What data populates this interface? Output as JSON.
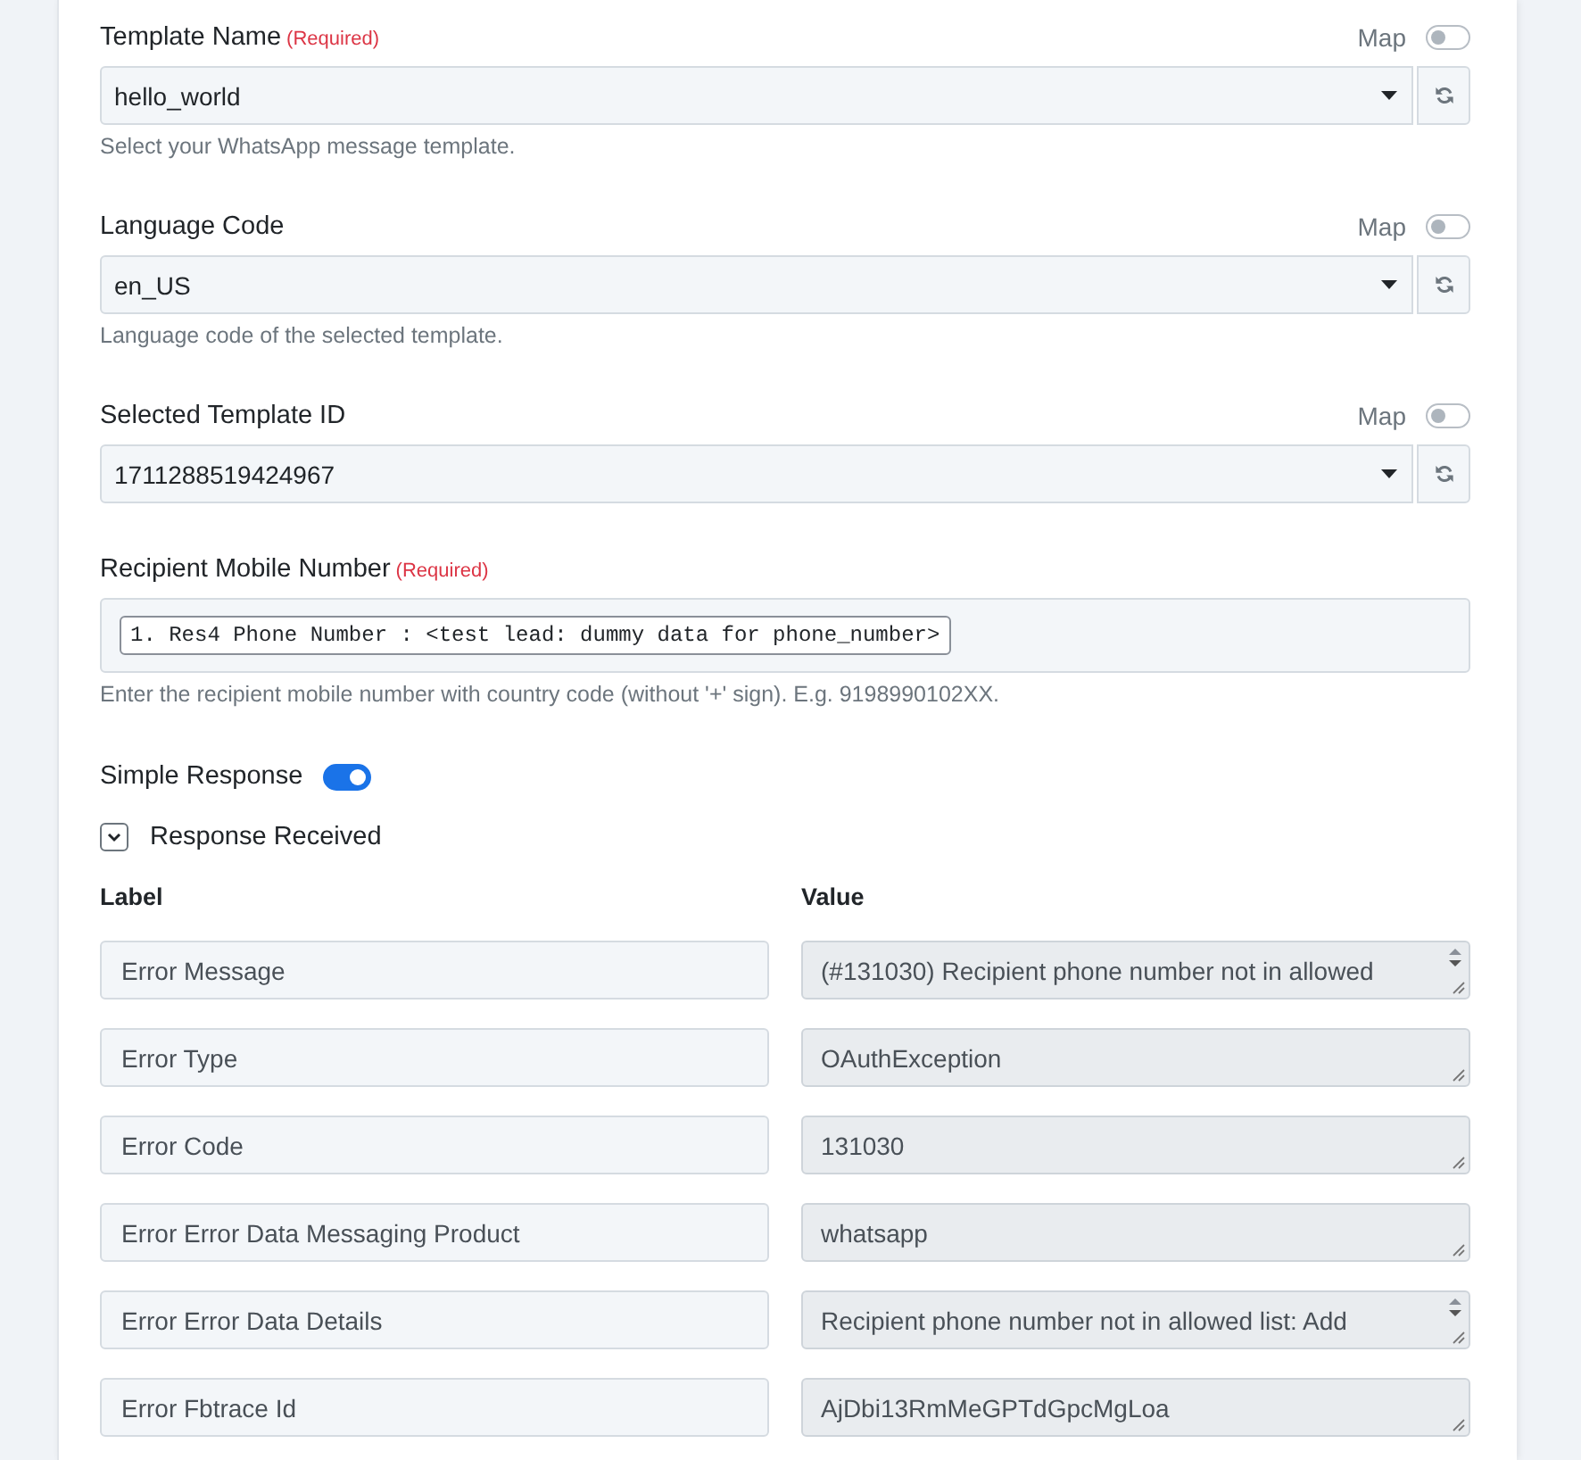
{
  "fields": [
    {
      "kind": "select",
      "label": "Template Name",
      "required_note": "(Required)",
      "map": {
        "label": "Map",
        "on": false
      },
      "value": "hello_world",
      "hint": "Select your WhatsApp message template."
    },
    {
      "kind": "select",
      "label": "Language Code",
      "map": {
        "label": "Map",
        "on": false
      },
      "value": "en_US",
      "hint": "Language code of the selected template."
    },
    {
      "kind": "select",
      "label": "Selected Template ID",
      "map": {
        "label": "Map",
        "on": false
      },
      "value": "1711288519424967"
    },
    {
      "kind": "tokens",
      "label": "Recipient Mobile Number",
      "required_note": "(Required)",
      "tokens": [
        "1. Res4 Phone Number : <test lead: dummy data for phone_number>"
      ],
      "hint": "Enter the recipient mobile number with country code (without '+' sign). E.g. 9198990102XX."
    }
  ],
  "simple_response": {
    "label": "Simple Response",
    "on": true
  },
  "response": {
    "label": "Response Received",
    "expanded": true,
    "columns": [
      "Label",
      "Value"
    ],
    "rows": [
      {
        "label": "Error Message",
        "value": "(#131030) Recipient phone number not in allowed",
        "scrollable": true
      },
      {
        "label": "Error Type",
        "value": "OAuthException",
        "scrollable": false
      },
      {
        "label": "Error Code",
        "value": "131030",
        "scrollable": false
      },
      {
        "label": "Error Error Data Messaging Product",
        "value": "whatsapp",
        "scrollable": false
      },
      {
        "label": "Error Error Data Details",
        "value": "Recipient phone number not in allowed list: Add",
        "scrollable": true
      },
      {
        "label": "Error Fbtrace Id",
        "value": "AjDbi13RmMeGPTdGpcMgLoa",
        "scrollable": false
      }
    ]
  }
}
